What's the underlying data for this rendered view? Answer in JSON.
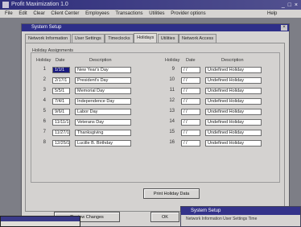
{
  "app": {
    "title": "Profit Maximization 1.0",
    "window_buttons": "_ □ ×"
  },
  "menu": [
    "File",
    "Edit",
    "Clear",
    "Client Center",
    "Employees",
    "Transactions",
    "Utilities",
    "Provider options",
    "Help"
  ],
  "dialog": {
    "title": "System Setup",
    "tabs": [
      "Network Information",
      "User Settings",
      "Timeclocks",
      "Holidays",
      "Utilities",
      "Network Access"
    ],
    "active_tab": "Holidays",
    "group_label": "Holiday Assignments",
    "headers": {
      "holiday": "Holiday",
      "date": "Date",
      "description": "Description"
    },
    "left_holidays": [
      {
        "num": "1",
        "date": "1/1/1",
        "desc": "New Year's Day",
        "selected": true
      },
      {
        "num": "2",
        "date": "2/17/1",
        "desc": "President's Day",
        "selected": false
      },
      {
        "num": "3",
        "date": "5/5/1",
        "desc": "Memorial Day",
        "selected": false
      },
      {
        "num": "4",
        "date": "7/4/1",
        "desc": "Independence Day",
        "selected": false
      },
      {
        "num": "5",
        "date": "9/6/1",
        "desc": "Labor Day",
        "selected": false
      },
      {
        "num": "6",
        "date": "11/11/1",
        "desc": "Veterans Day",
        "selected": false
      },
      {
        "num": "7",
        "date": "11/27/1",
        "desc": "Thanksgiving",
        "selected": false
      },
      {
        "num": "8",
        "date": "12/25/1",
        "desc": "Lucille B. Birthday",
        "selected": false
      }
    ],
    "right_holidays": [
      {
        "num": "9",
        "date": "/ /",
        "desc": "Undefined Holiday"
      },
      {
        "num": "10",
        "date": "/ /",
        "desc": "Undefined Holiday"
      },
      {
        "num": "11",
        "date": "/ /",
        "desc": "Undefined Holiday"
      },
      {
        "num": "12",
        "date": "/ /",
        "desc": "Undefined Holiday"
      },
      {
        "num": "13",
        "date": "/ /",
        "desc": "Undefined Holiday"
      },
      {
        "num": "14",
        "date": "/ /",
        "desc": "Undefined Holiday"
      },
      {
        "num": "15",
        "date": "/ /",
        "desc": "Undefined Holiday"
      },
      {
        "num": "16",
        "date": "/ /",
        "desc": "Undefined Holiday"
      }
    ],
    "print_button": "Print Holiday Data",
    "review_button": "Review Changes",
    "ok_button": "OK"
  },
  "popup": {
    "title": "System Setup",
    "tabs_text": "Network Information   User Settings   Time"
  }
}
